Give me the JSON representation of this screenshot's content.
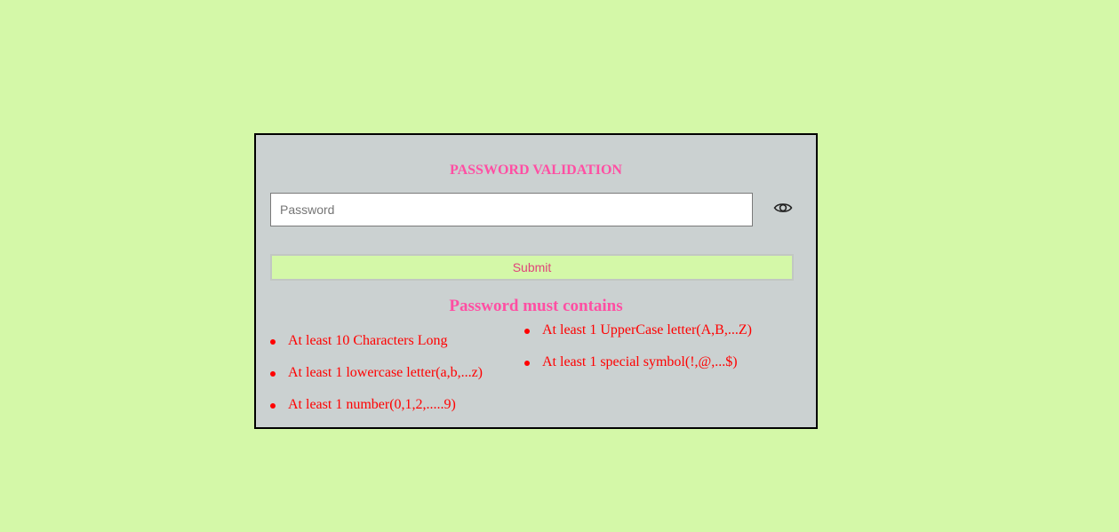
{
  "form": {
    "title": "PASSWORD VALIDATION",
    "password_placeholder": "Password",
    "password_value": "",
    "toggle_icon": "eye-icon",
    "submit_label": "Submit"
  },
  "rules": {
    "heading": "Password must contains",
    "left": [
      "At least 10 Characters Long",
      "At least 1 lowercase letter(a,b,...z)",
      "At least 1 number(0,1,2,.....9)"
    ],
    "right": [
      "At least 1 UpperCase letter(A,B,...Z)",
      "At least 1 special symbol(!,@,...$)"
    ]
  },
  "colors": {
    "page_background": "#d4f8a8",
    "card_background": "#cbd1d1",
    "title_pink": "#ff4fa3",
    "rule_red": "#ff0000",
    "submit_text": "#e0457b"
  }
}
